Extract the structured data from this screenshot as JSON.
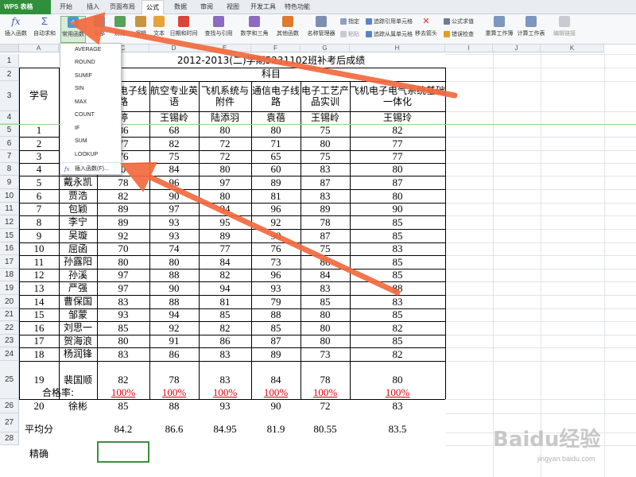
{
  "app": {
    "logo": "WPS 表格"
  },
  "menu_tabs": [
    "开始",
    "插入",
    "页面布局",
    "公式",
    "数据",
    "审阅",
    "视图",
    "开发工具",
    "特色功能"
  ],
  "active_tab": "公式",
  "ribbon": {
    "insert_function": "插入函数",
    "autosum": "自动求和",
    "common_functions": "常用函数",
    "all": "全部",
    "finance": "财务",
    "logic": "逻辑",
    "text": "文本",
    "datetime": "日期和时间",
    "lookup": "查找与引用",
    "math": "数学和三角",
    "other": "其他函数",
    "name_manager": "名称管理器",
    "specify": "指定",
    "paste": "粘贴",
    "trace_precedents": "追踪引用单元格",
    "trace_dependents": "追踪从属单元格",
    "remove_arrows": "移去箭头",
    "show_formulas": "公式求值",
    "error_check": "错误检查",
    "recalc_sheet": "重算工作簿",
    "calc_sheet": "计算工作表",
    "edit_links": "编辑链接"
  },
  "dropdown": {
    "items": [
      "AVERAGE",
      "ROUND",
      "SUMIF",
      "SIN",
      "MAX",
      "COUNT",
      "IF",
      "SUM",
      "LOOKUP"
    ],
    "insert_fn": "插入函数(F)..."
  },
  "columns": [
    "A",
    "B",
    "C",
    "D",
    "E",
    "F",
    "G",
    "H",
    "I",
    "J",
    "K"
  ],
  "row_numbers": [
    "1",
    "2",
    "3",
    "4",
    "5",
    "6",
    "7",
    "8",
    "9",
    "10",
    "11",
    "12",
    "15",
    "16",
    "17",
    "18",
    "19",
    "20",
    "21",
    "22",
    "23",
    "24",
    "25",
    "26",
    "27",
    "28"
  ],
  "sheet": {
    "title": "2012-2013(二)学期5231102班补考后成绩",
    "subject_header": "科目",
    "student_no": "学号",
    "subjects": [
      "飞机电子线路",
      "航空专业英语",
      "飞机系统与附件",
      "通信电子线路",
      "电子工艺产品实训",
      "飞机电子电气系统基础一体化"
    ],
    "teachers": [
      "婷",
      "王锡岭",
      "陆添羽",
      "袁蓓",
      "王锡岭",
      "王锡玲"
    ],
    "rows": [
      {
        "no": "1",
        "name": "",
        "s": [
          "86",
          "68",
          "80",
          "80",
          "75",
          "82"
        ]
      },
      {
        "no": "2",
        "name": "",
        "s": [
          "77",
          "82",
          "72",
          "71",
          "80",
          "77"
        ]
      },
      {
        "no": "3",
        "name": "",
        "s": [
          "76",
          "75",
          "72",
          "65",
          "75",
          "77"
        ]
      },
      {
        "no": "4",
        "name": "",
        "s": [
          "0",
          "84",
          "80",
          "60",
          "83",
          "80"
        ]
      },
      {
        "no": "5",
        "name": "戴永凯",
        "s": [
          "78",
          "96",
          "97",
          "89",
          "87",
          "87"
        ]
      },
      {
        "no": "6",
        "name": "贾浩",
        "s": [
          "82",
          "90",
          "80",
          "81",
          "83",
          "80"
        ]
      },
      {
        "no": "7",
        "name": "包颖",
        "s": [
          "89",
          "97",
          "94",
          "96",
          "89",
          "90"
        ]
      },
      {
        "no": "8",
        "name": "李宁",
        "s": [
          "89",
          "93",
          "95",
          "92",
          "78",
          "85"
        ]
      },
      {
        "no": "9",
        "name": "吴璇",
        "s": [
          "92",
          "93",
          "89",
          "90",
          "87",
          "85"
        ]
      },
      {
        "no": "10",
        "name": "屈函",
        "s": [
          "70",
          "74",
          "77",
          "76",
          "75",
          "83"
        ]
      },
      {
        "no": "11",
        "name": "孙露阳",
        "s": [
          "80",
          "80",
          "84",
          "73",
          "86",
          "85"
        ]
      },
      {
        "no": "12",
        "name": "孙溪",
        "s": [
          "97",
          "88",
          "82",
          "96",
          "84",
          "85"
        ]
      },
      {
        "no": "13",
        "name": "严强",
        "s": [
          "97",
          "90",
          "94",
          "93",
          "83",
          "88"
        ]
      },
      {
        "no": "14",
        "name": "曹保国",
        "s": [
          "83",
          "88",
          "81",
          "79",
          "85",
          "83"
        ]
      },
      {
        "no": "15",
        "name": "邹蒙",
        "s": [
          "93",
          "94",
          "85",
          "88",
          "80",
          "85"
        ]
      },
      {
        "no": "16",
        "name": "刘思一",
        "s": [
          "85",
          "92",
          "82",
          "85",
          "80",
          "82"
        ]
      },
      {
        "no": "17",
        "name": "贺海浪",
        "s": [
          "80",
          "91",
          "86",
          "87",
          "80",
          "85"
        ]
      },
      {
        "no": "18",
        "name": "杨润锋",
        "s": [
          "83",
          "86",
          "83",
          "89",
          "73",
          "82"
        ]
      },
      {
        "no": "19",
        "name": "裴国顺",
        "s": [
          "82",
          "78",
          "83",
          "84",
          "78",
          "80"
        ]
      },
      {
        "no": "20",
        "name": "徐彬",
        "s": [
          "85",
          "88",
          "93",
          "90",
          "72",
          "83"
        ]
      }
    ],
    "pass_rate_label": "合格率:",
    "pass_rates": [
      "100%",
      "100%",
      "100%",
      "100%",
      "100%",
      "100%"
    ],
    "avg_label": "平均分",
    "averages": [
      "84.2",
      "86.6",
      "84.95",
      "81.9",
      "80.55",
      "83.5"
    ],
    "precise_label": "精确"
  },
  "watermark": {
    "text": "Baidu经验",
    "url": "jingyan.baidu.com"
  },
  "colors": {
    "active_tab_bg": "#ffffff",
    "arrow": "#f26a3e",
    "pass_rate": "#e0000c",
    "dropdown_highlight": "#3fa34d"
  }
}
